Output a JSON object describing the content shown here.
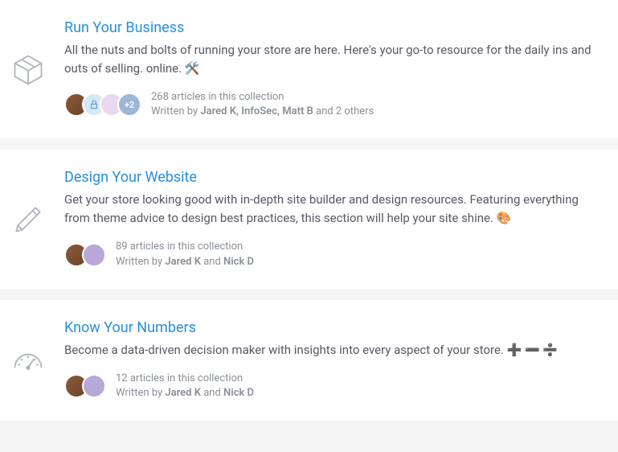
{
  "collections": [
    {
      "title": "Run Your Business",
      "description": "All the nuts and bolts of running your store are here. Here's your go-to resource for the daily ins and outs of selling. online. 🛠️",
      "article_count_text": "268 articles in this collection",
      "written_by_prefix": "Written by ",
      "authors_text": "Jared K, InfoSec, Matt B",
      "and_others": " and 2 others",
      "avatars_extra": "+2"
    },
    {
      "title": "Design Your Website",
      "description": "Get your store looking good with in-depth site builder and design resources. Featuring everything from theme advice to design best practices, this section will help your site shine. 🎨",
      "article_count_text": "89 articles in this collection",
      "written_by_prefix": "Written by ",
      "authors_text": "Jared K",
      "and_others": " and ",
      "authors_text2": "Nick D"
    },
    {
      "title": "Know Your Numbers",
      "description": "Become a data-driven decision maker with insights into every aspect of your store. ➕ ➖ ➗",
      "article_count_text": "12 articles in this collection",
      "written_by_prefix": "Written by ",
      "authors_text": "Jared K",
      "and_others": " and ",
      "authors_text2": "Nick D"
    }
  ]
}
